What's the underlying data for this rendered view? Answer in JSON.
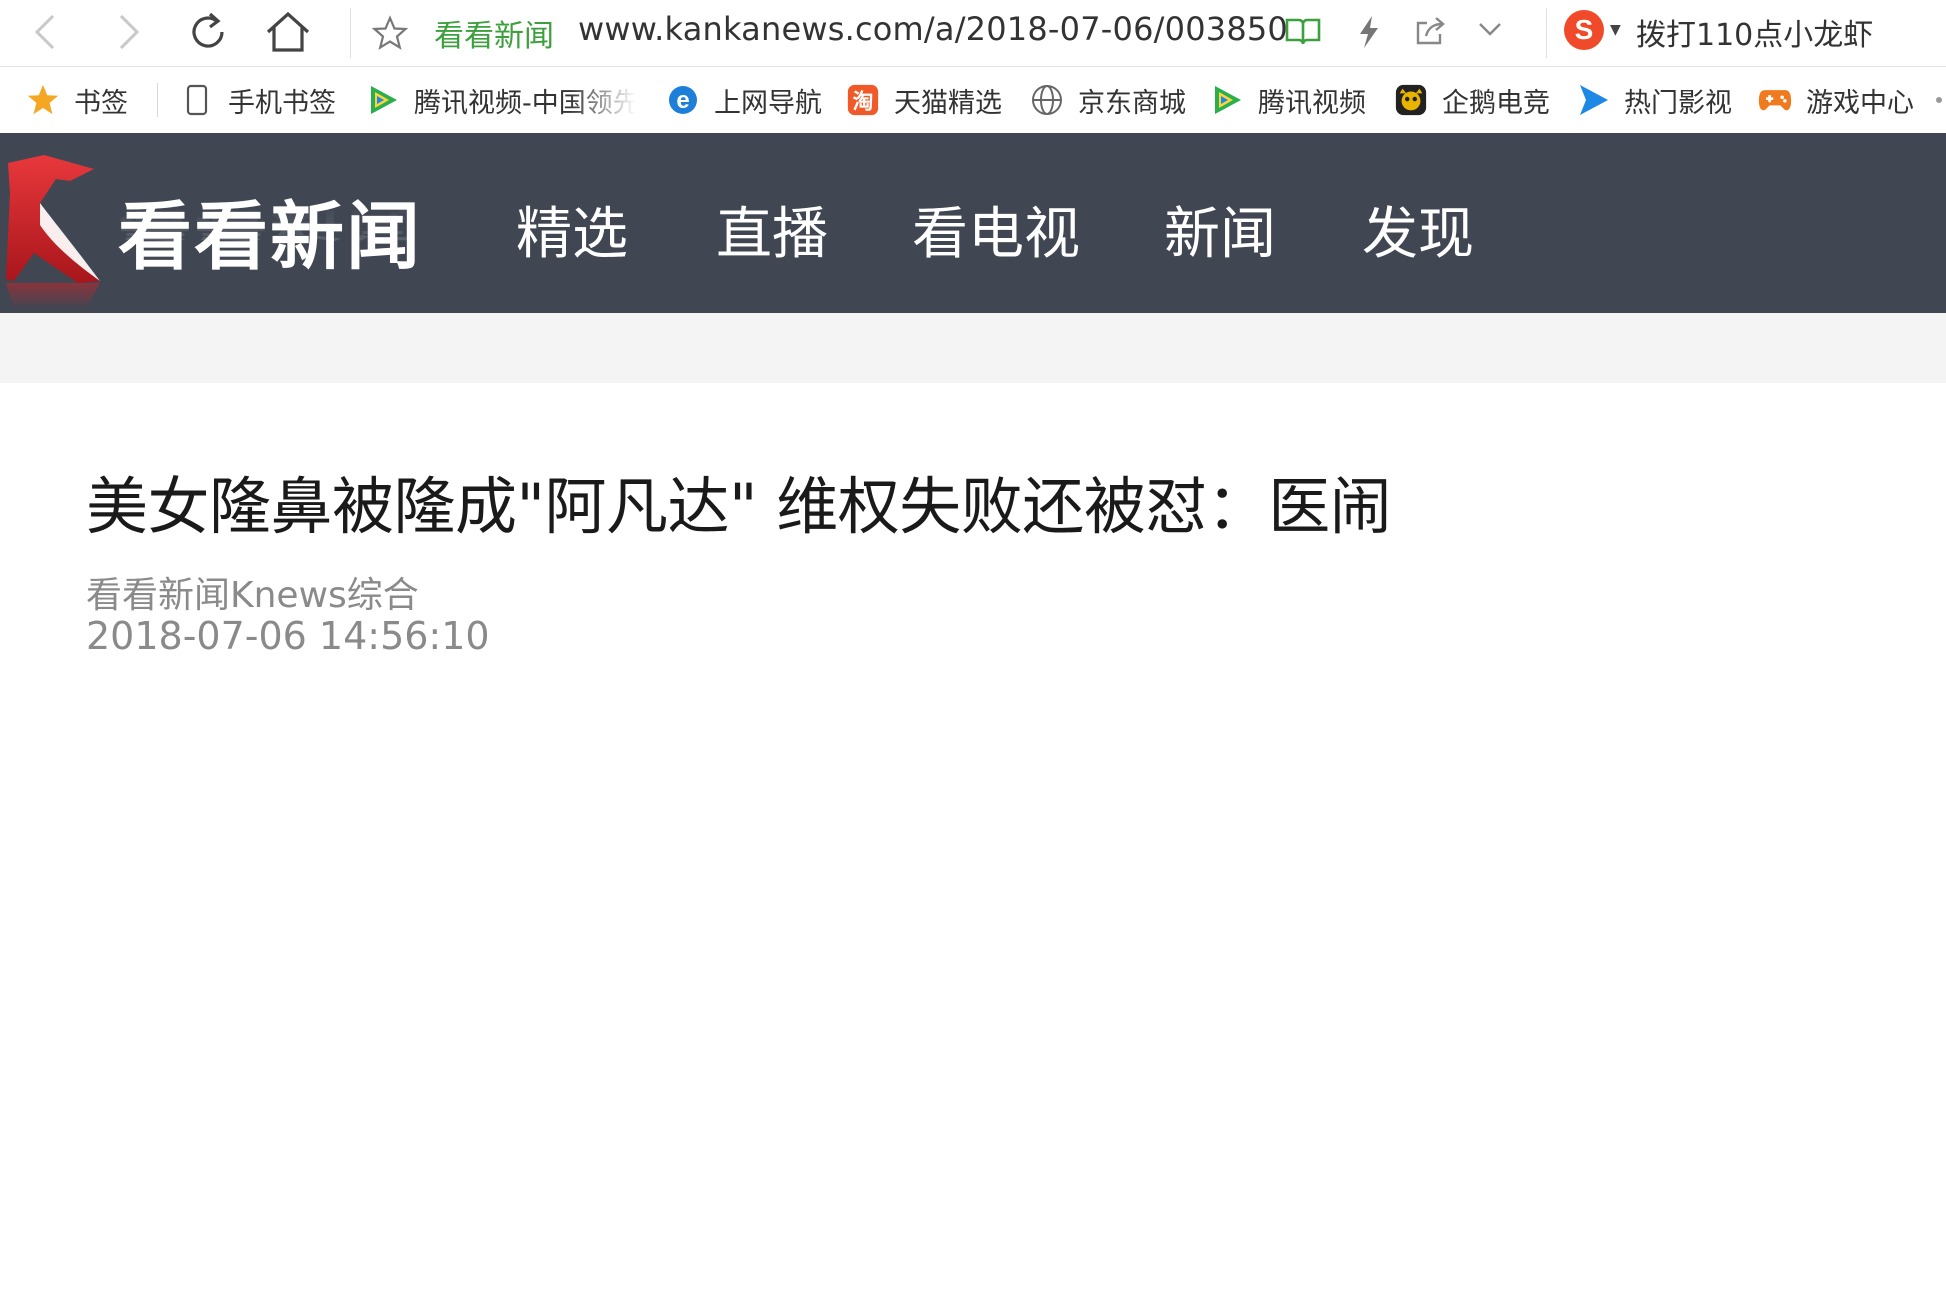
{
  "browser": {
    "address": {
      "site_name": "看看新闻",
      "url": "www.kankanews.com/a/2018-07-06/003850"
    },
    "search": {
      "engine_logo": "S",
      "query": "拨打110点小龙虾"
    },
    "icons": [
      "back-icon",
      "forward-icon",
      "refresh-icon",
      "home-icon",
      "bookmark-star-icon",
      "reader-mode-icon",
      "lightning-icon",
      "share-icon",
      "chevron-down-icon"
    ]
  },
  "bookmarks": [
    {
      "label": "书签",
      "icon": "star-icon",
      "color": "#f5a623"
    },
    {
      "label": "手机书签",
      "icon": "phone-icon",
      "color": "#555555"
    },
    {
      "label": "腾讯视频-中国领先",
      "icon": "tencent-video-icon",
      "color": "#2ab04a"
    },
    {
      "label": "上网导航",
      "icon": "ie-icon",
      "color": "#1e7fd8"
    },
    {
      "label": "天猫精选",
      "icon": "taobao-icon",
      "color": "#f05a28"
    },
    {
      "label": "京东商城",
      "icon": "globe-icon",
      "color": "#666666"
    },
    {
      "label": "腾讯视频",
      "icon": "tencent-video-icon",
      "color": "#2ab04a"
    },
    {
      "label": "企鹅电竞",
      "icon": "penguin-esports-icon",
      "color": "#e8b400"
    },
    {
      "label": "热门影视",
      "icon": "play-icon",
      "color": "#1e88e5"
    },
    {
      "label": "游戏中心",
      "icon": "gamepad-icon",
      "color": "#f07b1f"
    }
  ],
  "site": {
    "logo_text": "看看新闻",
    "nav": [
      "精选",
      "直播",
      "看电视",
      "新闻",
      "发现"
    ],
    "colors": {
      "header_bg": "#404652",
      "logo_red": "#d7262b"
    }
  },
  "article": {
    "title": "美女隆鼻被隆成\"阿凡达\" 维权失败还被怼：医闹",
    "source": "看看新闻Knews综合",
    "date": "2018-07-06 14:56:10"
  }
}
